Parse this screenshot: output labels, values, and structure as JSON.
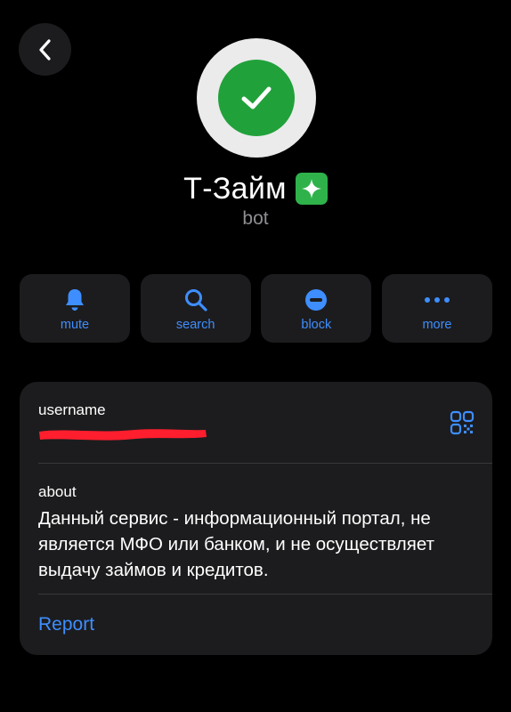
{
  "profile": {
    "name": "Т-Займ",
    "type": "bot",
    "avatar_icon": "check-icon",
    "avatar_bg": "#21a13a",
    "badge_icon": "sparkle-icon"
  },
  "actions": [
    {
      "label": "mute",
      "icon": "bell-icon"
    },
    {
      "label": "search",
      "icon": "search-icon"
    },
    {
      "label": "block",
      "icon": "block-icon"
    },
    {
      "label": "more",
      "icon": "ellipsis-icon"
    }
  ],
  "info": {
    "username_label": "username",
    "about_label": "about",
    "about_text": "Данный сервис - информационный портал, не является МФО или банком, и не осуществляет выдачу займов и кредитов.",
    "report_label": "Report"
  },
  "colors": {
    "accent": "#3e8eff",
    "card": "#1c1c1e",
    "redaction": "#ff1e2d"
  }
}
